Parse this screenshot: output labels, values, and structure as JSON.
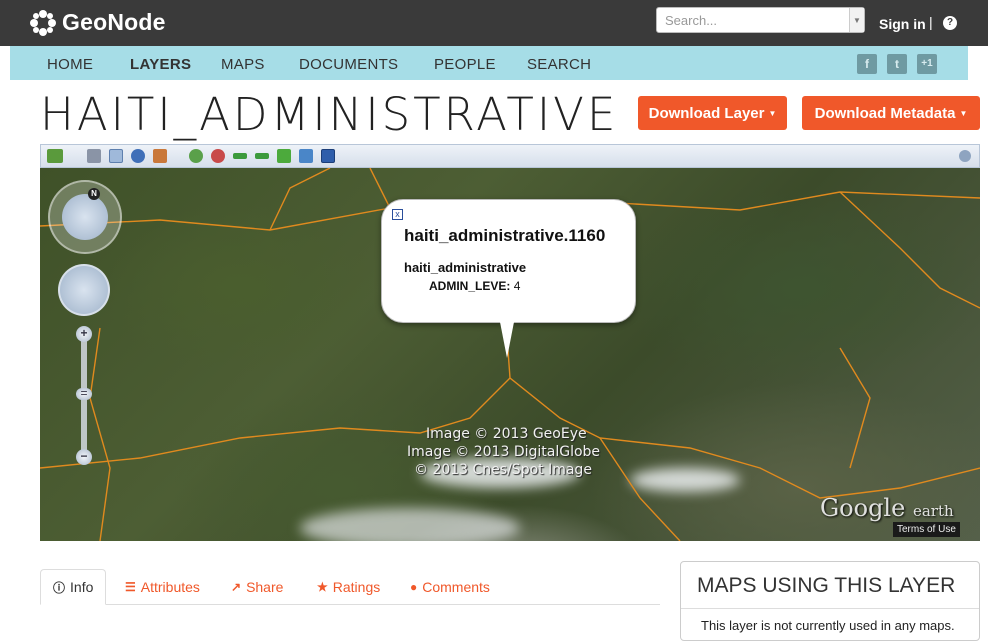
{
  "brand": {
    "name": "GeoNode"
  },
  "header": {
    "search_placeholder": "Search...",
    "signin_label": "Sign in",
    "separator": "|",
    "help_label": "?"
  },
  "nav": {
    "items": [
      "HOME",
      "LAYERS",
      "MAPS",
      "DOCUMENTS",
      "PEOPLE",
      "SEARCH"
    ],
    "active": "LAYERS",
    "social": [
      "f",
      "t",
      "+1"
    ]
  },
  "page": {
    "title": "HAITI_ADMINISTRATIVE",
    "download_layer": "Download Layer",
    "download_metadata": "Download Metadata"
  },
  "map": {
    "popup": {
      "title": "haiti_administrative.1160",
      "layer": "haiti_administrative",
      "attr_name": "ADMIN_LEVE:",
      "attr_value": "4",
      "close": "x"
    },
    "credits": [
      "Image © 2013 GeoEye",
      "Image © 2013 DigitalGlobe",
      "© 2013 Cnes/Spot Image"
    ],
    "google_logo": "Google",
    "google_earth": "earth",
    "terms": "Terms of Use",
    "north_label": "N",
    "zoom_in": "+",
    "zoom_out": "−",
    "zoom_handle": "="
  },
  "tabs": {
    "info": "Info",
    "attributes": "Attributes",
    "share": "Share",
    "ratings": "Ratings",
    "comments": "Comments"
  },
  "maps_panel": {
    "title": "MAPS USING THIS LAYER",
    "text": "This layer is not currently used in any maps."
  },
  "colors": {
    "accent": "#f0582a",
    "nav_bg": "#a6dde7",
    "topbar_bg": "#3a3a3a"
  }
}
